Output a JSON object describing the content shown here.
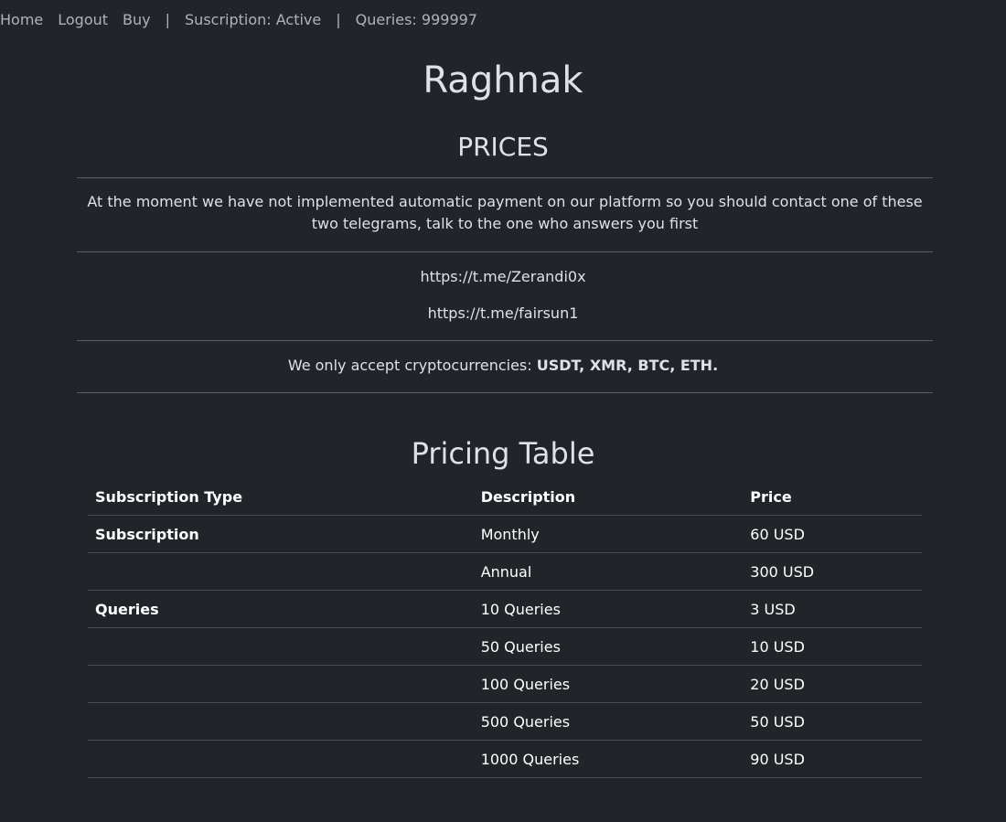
{
  "nav": {
    "home": "Home",
    "logout": "Logout",
    "buy": "Buy",
    "separator": "|",
    "subscription_status": "Suscription: Active",
    "queries_status": "Queries: 999997"
  },
  "header": {
    "site_title": "Raghnak",
    "section_title": "PRICES"
  },
  "notice": {
    "text": "At the moment we have not implemented automatic payment on our platform so you should contact one of these two telegrams, talk to the one who answers you first"
  },
  "contacts": {
    "link1": "https://t.me/Zerandi0x",
    "link2": "https://t.me/fairsun1"
  },
  "payment": {
    "prefix": "We only accept cryptocurrencies: ",
    "methods": "USDT, XMR, BTC, ETH."
  },
  "pricing_table": {
    "title": "Pricing Table",
    "headers": [
      "Subscription Type",
      "Description",
      "Price"
    ],
    "rows": [
      {
        "type": "Subscription",
        "description": "Monthly",
        "price": "60 USD"
      },
      {
        "type": "",
        "description": "Annual",
        "price": "300 USD"
      },
      {
        "type": "Queries",
        "description": "10 Queries",
        "price": "3 USD"
      },
      {
        "type": "",
        "description": "50 Queries",
        "price": "10 USD"
      },
      {
        "type": "",
        "description": "100 Queries",
        "price": "20 USD"
      },
      {
        "type": "",
        "description": "500 Queries",
        "price": "50 USD"
      },
      {
        "type": "",
        "description": "1000 Queries",
        "price": "90 USD"
      }
    ]
  },
  "colors": {
    "background": "#212529",
    "text": "#dee2e6",
    "nav_text": "#adb5bd",
    "table_text": "#ffffff",
    "border": "#4a4e53"
  }
}
